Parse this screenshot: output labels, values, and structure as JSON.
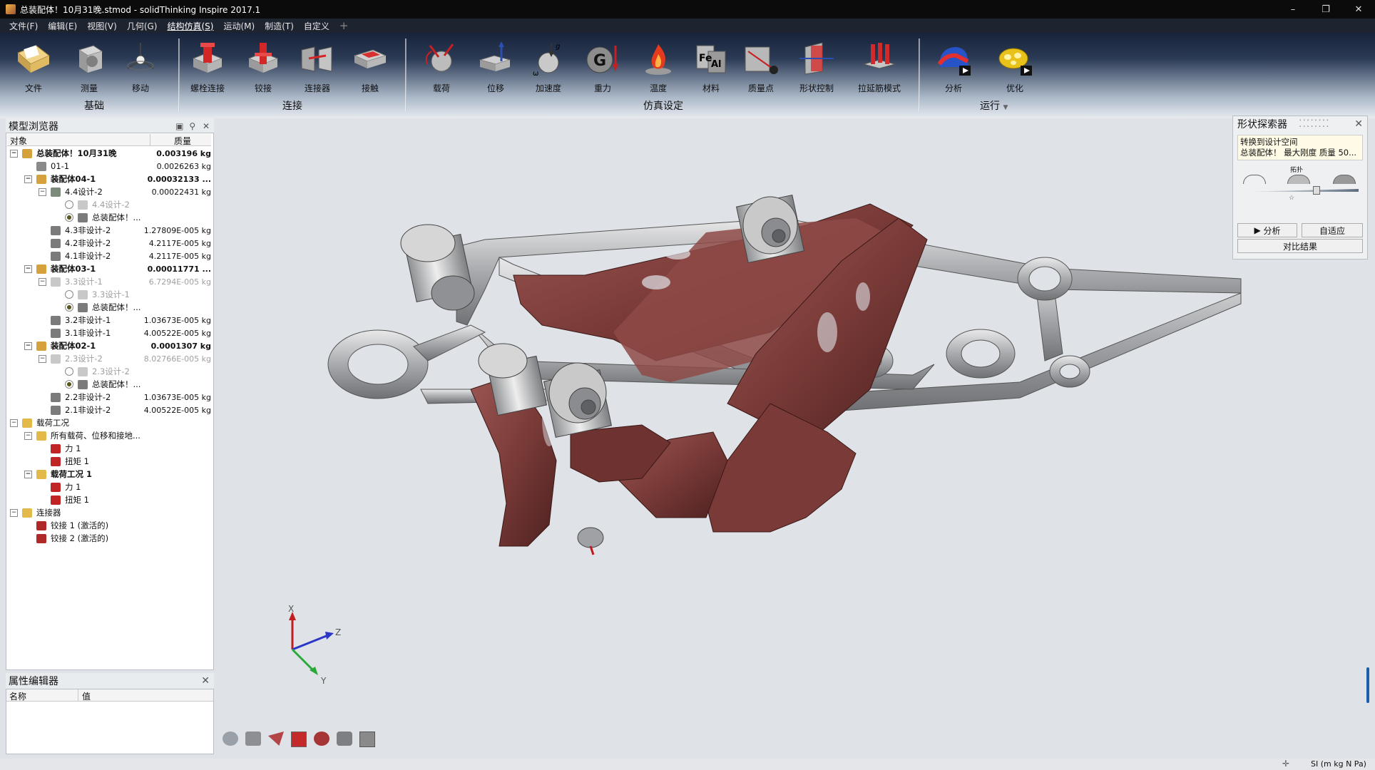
{
  "window": {
    "title": "总装配体！10月31晚.stmod - solidThinking Inspire 2017.1",
    "min": "–",
    "max": "❐",
    "close": "✕"
  },
  "menu": [
    "文件(F)",
    "编辑(E)",
    "视图(V)",
    "几何(G)",
    "结构仿真(S)",
    "运动(M)",
    "制造(T)",
    "自定义",
    "+"
  ],
  "ribbon": {
    "buttons": [
      "文件",
      "测量",
      "移动",
      "螺栓连接",
      "铰接",
      "连接器",
      "接触",
      "载荷",
      "位移",
      "加速度",
      "重力",
      "温度",
      "材料",
      "质量点",
      "形状控制",
      "拉延筋模式",
      "分析",
      "优化"
    ],
    "groups": [
      "基础",
      "连接",
      "仿真设定",
      "运行"
    ],
    "run_arrow": "▼"
  },
  "browser": {
    "title": "模型浏览器",
    "col_object": "对象",
    "col_mass": "质量",
    "rows": [
      {
        "label": "总装配体！10月31晚",
        "mass": "0.003196 kg"
      },
      {
        "label": "01-1",
        "mass": "0.0026263 kg"
      },
      {
        "label": "装配体04-1",
        "mass": "0.00032133 ..."
      },
      {
        "label": "4.4设计-2",
        "mass": "0.00022431 kg"
      },
      {
        "label": "4.4设计-2",
        "mass": ""
      },
      {
        "label": "总装配体！...",
        "mass": ""
      },
      {
        "label": "4.3非设计-2",
        "mass": "1.27809E-005 kg"
      },
      {
        "label": "4.2非设计-2",
        "mass": "4.2117E-005 kg"
      },
      {
        "label": "4.1非设计-2",
        "mass": "4.2117E-005 kg"
      },
      {
        "label": "装配体03-1",
        "mass": "0.00011771 ..."
      },
      {
        "label": "3.3设计-1",
        "mass": "6.7294E-005 kg"
      },
      {
        "label": "3.3设计-1",
        "mass": ""
      },
      {
        "label": "总装配体！...",
        "mass": ""
      },
      {
        "label": "3.2非设计-1",
        "mass": "1.03673E-005 kg"
      },
      {
        "label": "3.1非设计-1",
        "mass": "4.00522E-005 kg"
      },
      {
        "label": "装配体02-1",
        "mass": "0.0001307 kg"
      },
      {
        "label": "2.3设计-2",
        "mass": "8.02766E-005 kg"
      },
      {
        "label": "2.3设计-2",
        "mass": ""
      },
      {
        "label": "总装配体！...",
        "mass": ""
      },
      {
        "label": "2.2非设计-2",
        "mass": "1.03673E-005 kg"
      },
      {
        "label": "2.1非设计-2",
        "mass": "4.00522E-005 kg"
      },
      {
        "label": "载荷工况",
        "mass": ""
      },
      {
        "label": "所有载荷、位移和接地...",
        "mass": ""
      },
      {
        "label": "力 1",
        "mass": ""
      },
      {
        "label": "扭矩 1",
        "mass": ""
      },
      {
        "label": "载荷工况 1",
        "mass": ""
      },
      {
        "label": "力 1",
        "mass": ""
      },
      {
        "label": "扭矩 1",
        "mass": ""
      },
      {
        "label": "连接器",
        "mass": ""
      },
      {
        "label": "铰接 1 (激活的)",
        "mass": ""
      },
      {
        "label": "铰接 2 (激活的)",
        "mass": ""
      }
    ]
  },
  "props": {
    "title": "属性编辑器",
    "col_name": "名称",
    "col_value": "值"
  },
  "shape_explorer": {
    "title": "形状探索器",
    "line1": "转换到设计空间",
    "line2": "总装配体！  最大刚度 质量 50...",
    "slider_label": "拓扑",
    "analyze": "分析",
    "adapt": "自适应",
    "compare": "对比结果"
  },
  "axis": {
    "x": "X",
    "y": "Y",
    "z": "Z"
  },
  "status": {
    "units": "SI (m kg N Pa)"
  },
  "colors": {
    "design": "#7a3b38",
    "metal": "#b5b7ba",
    "viewport": "#dfe3e8",
    "accent": "#1b5fa8"
  }
}
